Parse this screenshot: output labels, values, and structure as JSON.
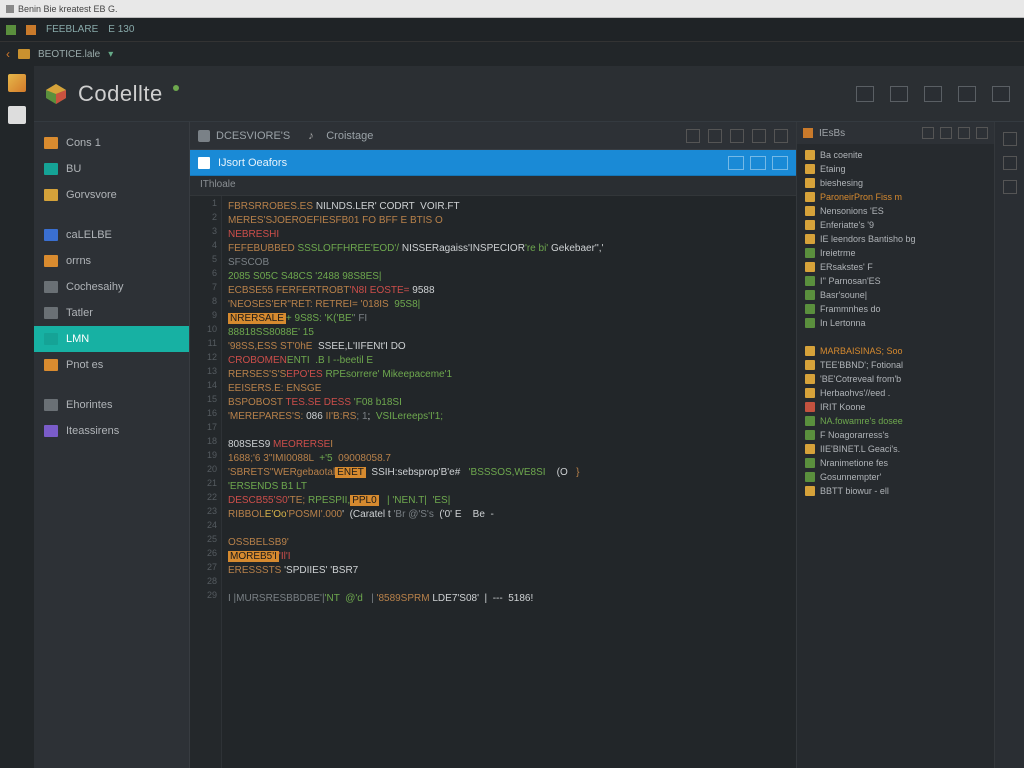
{
  "titlebar": {
    "text": "Benin Bie kreatest EB G."
  },
  "topstrip": {
    "label1": "FEEBLARE",
    "label2": "E 130"
  },
  "topstrip2": {
    "label": "BEOTICE.lale"
  },
  "brand": {
    "name": "Codellte"
  },
  "sidebar": {
    "items": [
      {
        "label": "Cons 1",
        "icon": "orange"
      },
      {
        "label": "BU",
        "icon": "teal"
      },
      {
        "label": "Gorvsvore",
        "icon": "gold"
      },
      {
        "label": "caLELBE",
        "icon": "blue"
      },
      {
        "label": "orrns",
        "icon": "orange"
      },
      {
        "label": "Cochesaihy",
        "icon": "grey"
      },
      {
        "label": "Tatler",
        "icon": "grey"
      },
      {
        "label": "LMN",
        "icon": "teal",
        "selected": true
      },
      {
        "label": "Pnot es",
        "icon": "orange"
      },
      {
        "label": "Ehorintes",
        "icon": "grey"
      },
      {
        "label": "Iteassirens",
        "icon": "purple"
      }
    ]
  },
  "tabs": {
    "tab1": "DCESVIORE'S",
    "tab2": "Croistage"
  },
  "activebar": {
    "title": "IJsort Oeafors"
  },
  "subheader": "IThloale",
  "code_lines": [
    [
      [
        "c-brown",
        "FBRSRROBES.ES "
      ],
      [
        "c-white",
        "NILNDS.LER' CODRT  VOIR.FT"
      ]
    ],
    [
      [
        "c-brown",
        "MERES'SJOEROEFIESFB01 FO BFF E BTIS O"
      ]
    ],
    [
      [
        "c-red",
        "NEBRESHI"
      ]
    ],
    [
      [
        "c-brown",
        "FEFEBUBBED "
      ],
      [
        "c-green",
        "SSSLOFFHREE'EOD'/ "
      ],
      [
        "c-white",
        "NISSERagaiss'INSPECIOR"
      ],
      [
        "c-green",
        "'re bi' "
      ],
      [
        "c-white",
        "Gekebaer'','"
      ]
    ],
    [
      [
        "c-grey",
        "SFSCOB"
      ]
    ],
    [
      [
        "c-green",
        "2085 S05C "
      ],
      [
        "c-green",
        "S48CS '2488 98S8ES|"
      ]
    ],
    [
      [
        "c-brown",
        "ECBSE55 "
      ],
      [
        "c-brown",
        "FERFERTROBT"
      ],
      [
        "c-red",
        "'N8I EOSTE= "
      ],
      [
        "c-white",
        "9588"
      ]
    ],
    [
      [
        "c-brown",
        "'NEOSES'ER\"RET: "
      ],
      [
        "c-brown",
        "RETREI= '018IS"
      ],
      [
        "c-green",
        "  95S8|"
      ]
    ],
    [
      [
        "c-orange",
        "NRERSALE"
      ],
      [
        "c-green",
        "+ 9S8S: 'K('BE'"
      ],
      [
        "c-grey",
        "' FI"
      ]
    ],
    [
      [
        "c-green",
        "88818SS8088E' 15"
      ]
    ],
    [
      [
        "c-brown",
        "'98SS,ESS ST'0hE"
      ],
      [
        "c-white",
        "  SSEE,L'IIFENt'I DO"
      ]
    ],
    [
      [
        "c-red",
        "CROBOMEN"
      ],
      [
        "c-green",
        "ENTI  .B I --beetil E"
      ]
    ],
    [
      [
        "c-brown",
        "RERSES'S'S"
      ],
      [
        "c-red",
        "EPO'ES "
      ],
      [
        "c-green",
        "RPEsorrere' Mikeepaceme'1"
      ]
    ],
    [
      [
        "c-brown",
        "EEISERS.E: "
      ],
      [
        "c-brown",
        "ENSGE"
      ]
    ],
    [
      [
        "c-brown",
        "BSPOBOST "
      ],
      [
        "c-red",
        "TES.SE DESS "
      ],
      [
        "c-green",
        "'F08 b18SI"
      ]
    ],
    [
      [
        "c-brown",
        "'MEREPARES'S: "
      ],
      [
        "c-white",
        "086 "
      ],
      [
        "c-brown",
        "II'B:RS"
      ],
      [
        "c-grey",
        "; 1"
      ],
      [
        "c-white",
        ";  "
      ],
      [
        "c-green",
        "VSILereeps'I'1;"
      ]
    ],
    [
      [
        "c-grey",
        ""
      ]
    ],
    [
      [
        "c-white",
        "808SES9 "
      ],
      [
        "c-red",
        "MEORERSE"
      ],
      [
        "c-brown",
        "I"
      ]
    ],
    [
      [
        "c-brown",
        "1688;'6 3\"IMI0088L"
      ],
      [
        "c-green",
        "  +'5"
      ],
      [
        "c-brown",
        "  09008058.7"
      ]
    ],
    [
      [
        "c-brown",
        "'SBRETS\"WERgebaotal"
      ],
      [
        "c-orange",
        "ENET"
      ],
      [
        "c-white",
        "  SSIH:sebsprop'B'e#   "
      ],
      [
        "c-green",
        "'BSSSOS,WE8SI"
      ],
      [
        "c-white",
        "    (O   "
      ],
      [
        "c-brown",
        "}"
      ]
    ],
    [
      [
        "c-green",
        "'ERSENDS B1 LT"
      ]
    ],
    [
      [
        "c-red",
        "DESCB55'S0"
      ],
      [
        "c-brown",
        "'TE; "
      ],
      [
        "c-green",
        "RPESPII,"
      ],
      [
        "c-orange",
        "PPL0"
      ],
      [
        "c-green",
        "   | 'NEN.T|  'ES|"
      ]
    ],
    [
      [
        "c-brown",
        "RIBBOL"
      ],
      [
        "c-yellow",
        "E'Oo"
      ],
      [
        "c-brown",
        "'POSMI'.000"
      ],
      [
        "c-white",
        "'  (Caratel t "
      ],
      [
        "c-grey",
        "'Br @'S's"
      ],
      [
        "c-white",
        "  ('0' E    Be  -"
      ]
    ],
    [
      [
        "c-grey",
        ""
      ]
    ],
    [
      [
        "c-brown",
        "OSSBELSB9'"
      ]
    ],
    [
      [
        "c-orange",
        "MOREB5'I"
      ],
      [
        "c-red",
        "'Il'I"
      ]
    ],
    [
      [
        "c-brown",
        "ERESSSTS "
      ],
      [
        "c-white",
        "'SPDIIES' 'BSR7"
      ]
    ],
    [
      [
        "c-grey",
        ""
      ]
    ],
    [
      [
        "c-grey",
        "I |MURSRESBBDBE'|"
      ],
      [
        "c-green",
        "'NT  @'d  "
      ],
      [
        "c-grey",
        " | "
      ],
      [
        "c-brown",
        "'8589SPRM "
      ],
      [
        "c-white",
        "LDE7'S08'  |  --- "
      ],
      [
        "c-white",
        " 5186!"
      ]
    ]
  ],
  "outline": {
    "title": "IEsBs",
    "items": [
      {
        "label": "Ba coenite",
        "c": "y"
      },
      {
        "label": "Etaing",
        "c": "y"
      },
      {
        "label": "bieshesing",
        "c": "y"
      },
      {
        "label": "ParoneirPron Fiss m",
        "c": "y",
        "tone": "orange"
      },
      {
        "label": "Nensonions 'ES",
        "c": "y"
      },
      {
        "label": "Enferiatte's '9",
        "c": "y"
      },
      {
        "label": "IE leendors Bantisho bg",
        "c": "y"
      },
      {
        "label": "Ireietrme",
        "c": "g"
      },
      {
        "label": "ERsakstes' F",
        "c": "y"
      },
      {
        "label": "I'' Parnosan'ES",
        "c": "g"
      },
      {
        "label": "Basr'soune|",
        "c": "g"
      },
      {
        "label": "Frammnhes do",
        "c": "g"
      },
      {
        "label": "In Lertonna",
        "c": "g"
      },
      {
        "label": "",
        "c": ""
      },
      {
        "label": "MARBAISINAS;  Soo",
        "c": "y",
        "tone": "orange"
      },
      {
        "label": "TEE'BBND'; Fotional",
        "c": "y"
      },
      {
        "label": "'BE'Cotreveal from'b",
        "c": "y"
      },
      {
        "label": "Herbaohvs'//eed .",
        "c": "y"
      },
      {
        "label": "IRIT Koone",
        "c": "r"
      },
      {
        "label": "NA.fowamre's dosee",
        "c": "g",
        "tone": "green"
      },
      {
        "label": "F Noagorarress's",
        "c": "g"
      },
      {
        "label": "IIE'BINET.L Geaci's.",
        "c": "y"
      },
      {
        "label": "Nranimetione fes",
        "c": "g"
      },
      {
        "label": "Gosunnempter'",
        "c": "g"
      },
      {
        "label": "BBTT biowur - ell",
        "c": "y"
      }
    ]
  }
}
